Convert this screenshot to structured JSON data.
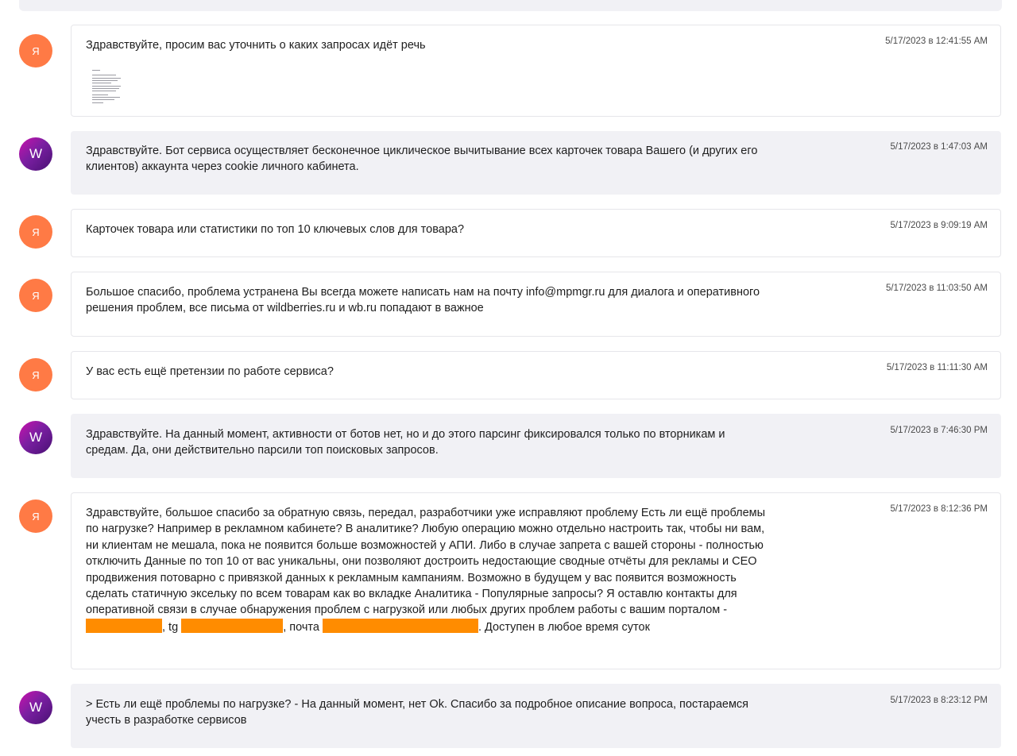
{
  "messages": [
    {
      "avatar": "Я",
      "text": "Здравствуйте, просим вас уточнить о каких запросах идёт речь",
      "timestamp": "5/17/2023 в 12:41:55 AM"
    },
    {
      "avatar": "W",
      "text": "Здравствуйте. Бот сервиса осуществляет бесконечное циклическое вычитывание всех карточек товара Вашего (и других его клиентов) аккаунта через cookie личного кабинета.",
      "timestamp": "5/17/2023 в 1:47:03 AM"
    },
    {
      "avatar": "Я",
      "text": "Карточек товара или статистики по топ 10 ключевых слов для товара?",
      "timestamp": "5/17/2023 в 9:09:19 AM"
    },
    {
      "avatar": "Я",
      "text": "Большое спасибо, проблема устранена Вы всегда можете написать нам на почту info@mpmgr.ru для диалога и оперативного решения проблем, все письма от wildberries.ru и wb.ru попадают в важное",
      "timestamp": "5/17/2023 в 11:03:50 AM"
    },
    {
      "avatar": "Я",
      "text": "У вас есть ещё претензии по работе сервиса?",
      "timestamp": "5/17/2023 в 11:11:30 AM"
    },
    {
      "avatar": "W",
      "text": "Здравствуйте. На данный момент, активности от ботов нет, но и до этого парсинг фиксировался только по вторникам и средам. Да, они действительно парсили топ поисковых запросов.",
      "timestamp": "5/17/2023 в 7:46:30 PM"
    },
    {
      "avatar": "Я",
      "text_main": "Здравствуйте, большое спасибо за обратную связь, передал, разработчики уже исправляют проблему Есть ли ещё проблемы по нагрузке? Например в рекламном кабинете? В аналитике? Любую операцию можно отдельно настроить так, чтобы ни вам, ни клиентам не мешала, пока не появится больше возможностей у АПИ. Либо в случае запрета с вашей стороны - полностью отключить Данные по топ 10 от вас уникальны, они позволяют достроить недостающие сводные отчёты для рекламы и СЕО продвижения потоварно с привязкой данных к рекламным кампаниям. Возможно в будущем у вас появится возможность сделать статичную эксельку по всем товарам как во вкладке Аналитика - Популярные запросы? Я оставлю контакты для оперативной связи в случае обнаружения проблем с нагрузкой или любых других проблем работы с вашим порталом -",
      "text_tg": ", tg",
      "text_mail": ", почта",
      "text_end": ". Доступен в любое время суток",
      "timestamp": "5/17/2023 в 8:12:36 PM"
    },
    {
      "avatar": "W",
      "text": "> Есть ли ещё проблемы по нагрузке? - На данный момент, нет Ok. Спасибо за подробное описание вопроса, постараемся учесть в разработке сервисов",
      "timestamp": "5/17/2023 в 8:23:12 PM"
    }
  ],
  "colors": {
    "ya_avatar": "#ff7a45",
    "w_avatar": "#7b1fa2",
    "incoming_bg": "#f1f1f5",
    "redaction": "#ff8c00"
  }
}
